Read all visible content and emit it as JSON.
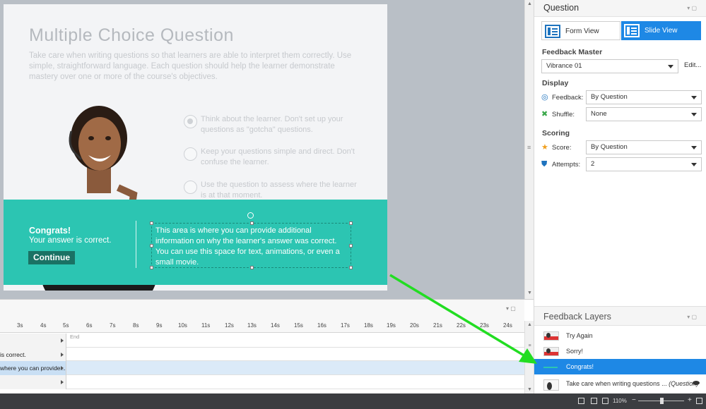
{
  "slide": {
    "title": "Multiple Choice Question",
    "description": "Take care when writing questions so that learners are able to interpret them correctly. Use simple, straightforward language. Each question should help the learner demonstrate mastery over one or more of the course's objectives.",
    "choices": [
      "Think about the learner. Don't set up your questions as \"gotcha\" questions.",
      "Keep your questions simple and direct. Don't confuse the learner.",
      "Use the question to assess where the learner is at that moment."
    ],
    "feedback": {
      "heading": "Congrats!",
      "subtext": "Your answer is correct.",
      "button_label": "Continue",
      "body": "This area is where you can provide additional information on why the learner's answer was correct. You can use this space for text, animations, or even a small movie.",
      "band_color": "#2cc5b2"
    }
  },
  "question_panel": {
    "title": "Question",
    "form_view_label": "Form View",
    "slide_view_label": "Slide View",
    "feedback_master_label": "Feedback Master",
    "feedback_master_value": "Vibrance 01",
    "edit_label": "Edit...",
    "display_label": "Display",
    "feedback_label": "Feedback:",
    "feedback_value": "By Question",
    "shuffle_label": "Shuffle:",
    "shuffle_value": "None",
    "scoring_label": "Scoring",
    "score_label": "Score:",
    "score_value": "By Question",
    "attempts_label": "Attempts:",
    "attempts_value": "2",
    "accent_color": "#1e88e5"
  },
  "layers_panel": {
    "title": "Feedback Layers",
    "layers": [
      {
        "label": "Try Again"
      },
      {
        "label": "Sorry!"
      },
      {
        "label": "Congrats!"
      }
    ],
    "base_layer": {
      "label": "Take care when writing questions ...",
      "tag": "(Question)"
    }
  },
  "timeline": {
    "ticks": [
      "3s",
      "4s",
      "5s",
      "6s",
      "7s",
      "8s",
      "9s",
      "10s",
      "11s",
      "12s",
      "13s",
      "14s",
      "15s",
      "16s",
      "17s",
      "18s",
      "19s",
      "20s",
      "21s",
      "22s",
      "23s",
      "24s"
    ],
    "end_label": "End",
    "tracks": [
      "is correct.",
      "where you can provide..."
    ]
  },
  "statusbar": {
    "zoom": "110%",
    "minus": "−",
    "plus": "+"
  },
  "annotation": {
    "arrow_color": "#22dd22"
  }
}
